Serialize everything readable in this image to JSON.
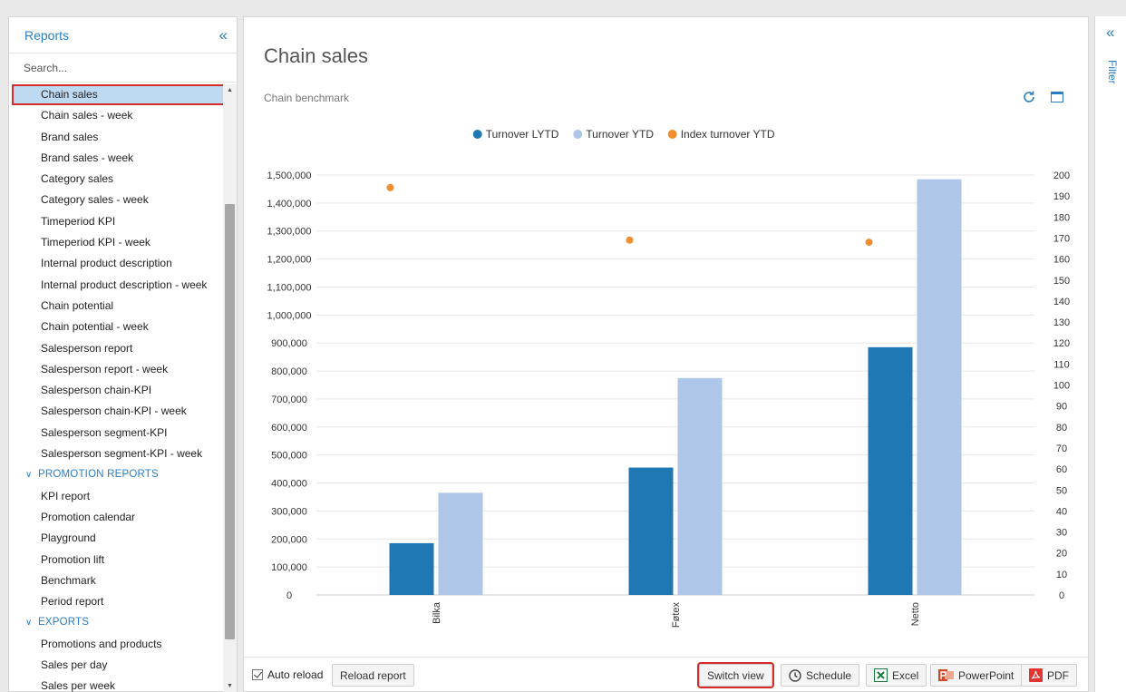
{
  "sidebar": {
    "title": "Reports",
    "search_placeholder": "Search...",
    "items": [
      {
        "label": "Chain sales",
        "selected": true
      },
      {
        "label": "Chain sales - week"
      },
      {
        "label": "Brand sales"
      },
      {
        "label": "Brand sales - week"
      },
      {
        "label": "Category sales"
      },
      {
        "label": "Category sales - week"
      },
      {
        "label": "Timeperiod KPI"
      },
      {
        "label": "Timeperiod KPI - week"
      },
      {
        "label": "Internal product description"
      },
      {
        "label": "Internal product description - week"
      },
      {
        "label": "Chain potential"
      },
      {
        "label": "Chain potential - week"
      },
      {
        "label": "Salesperson report"
      },
      {
        "label": "Salesperson report - week"
      },
      {
        "label": "Salesperson chain-KPI"
      },
      {
        "label": "Salesperson chain-KPI - week"
      },
      {
        "label": "Salesperson segment-KPI"
      },
      {
        "label": "Salesperson segment-KPI - week"
      },
      {
        "label": "PROMOTION REPORTS",
        "group": true
      },
      {
        "label": "KPI report"
      },
      {
        "label": "Promotion calendar"
      },
      {
        "label": "Playground"
      },
      {
        "label": "Promotion lift"
      },
      {
        "label": "Benchmark"
      },
      {
        "label": "Period report"
      },
      {
        "label": "EXPORTS",
        "group": true
      },
      {
        "label": "Promotions and products"
      },
      {
        "label": "Sales per day"
      },
      {
        "label": "Sales per week"
      }
    ]
  },
  "main": {
    "title": "Chain sales",
    "subtitle": "Chain benchmark"
  },
  "footer": {
    "auto_reload_label": "Auto reload",
    "auto_reload_checked": true,
    "reload_label": "Reload report",
    "switch_view_label": "Switch view",
    "schedule_label": "Schedule",
    "excel_label": "Excel",
    "powerpoint_label": "PowerPoint",
    "pdf_label": "PDF"
  },
  "filter": {
    "label": "Filter"
  },
  "colors": {
    "accent": "#2a7ec5",
    "series_lytd": "#1f77b4",
    "series_ytd": "#aec7e8",
    "series_index": "#f28e2b"
  },
  "chart_data": {
    "type": "bar",
    "categories": [
      "Bilka",
      "Føtex",
      "Netto"
    ],
    "series": [
      {
        "name": "Turnover LYTD",
        "type": "bar",
        "axis": "left",
        "values": [
          185000,
          455000,
          885000
        ]
      },
      {
        "name": "Turnover YTD",
        "type": "bar",
        "axis": "left",
        "values": [
          365000,
          775000,
          1485000
        ]
      },
      {
        "name": "Index turnover YTD",
        "type": "scatter",
        "axis": "right",
        "values": [
          194,
          169,
          168
        ]
      }
    ],
    "y_left": {
      "range": [
        0,
        1500000
      ],
      "ticks": [
        "0",
        "100,000",
        "200,000",
        "300,000",
        "400,000",
        "500,000",
        "600,000",
        "700,000",
        "800,000",
        "900,000",
        "1,000,000",
        "1,100,000",
        "1,200,000",
        "1,300,000",
        "1,400,000",
        "1,500,000"
      ]
    },
    "y_right": {
      "range": [
        0,
        200
      ],
      "ticks": [
        "0",
        "10",
        "20",
        "30",
        "40",
        "50",
        "60",
        "70",
        "80",
        "90",
        "100",
        "110",
        "120",
        "130",
        "140",
        "150",
        "160",
        "170",
        "180",
        "190",
        "200"
      ]
    },
    "legend": "top-center",
    "grid": true
  }
}
